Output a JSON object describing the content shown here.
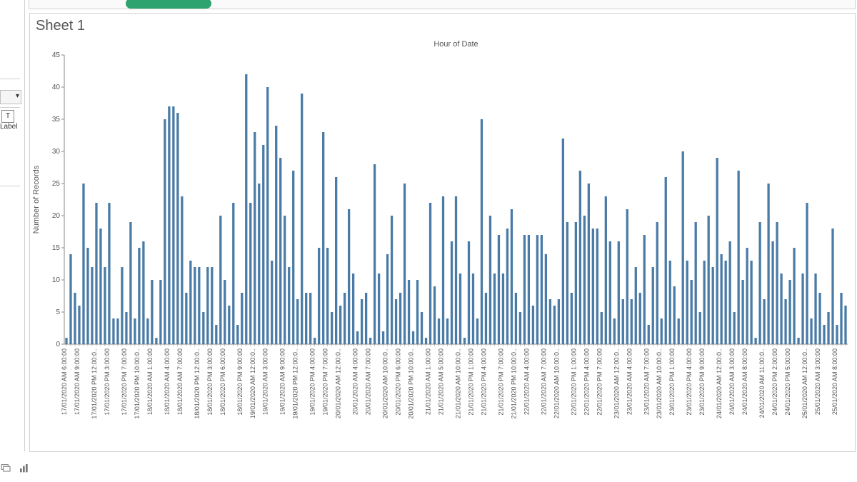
{
  "sheet_title": "Sheet 1",
  "left_panel": {
    "label_text": "Label",
    "t_box": "T",
    "dropdown_caret": "▾"
  },
  "bottom_icons": {
    "icon1": "data-source-icon",
    "icon2": "sheet-icon"
  },
  "chart_data": {
    "type": "bar",
    "title": "Hour of Date",
    "xlabel": "",
    "ylabel": "Number of Records",
    "ylim": [
      0,
      45
    ],
    "yticks": [
      0,
      5,
      10,
      15,
      20,
      25,
      30,
      35,
      40,
      45
    ],
    "categories": [
      "17/01/2020 AM 6:00:00",
      "17/01/2020 AM 9:00:00",
      "17/01/2020 PM 12:00:0..",
      "17/01/2020 PM 3:00:00",
      "17/01/2020 PM 7:00:00",
      "17/01/2020 PM 10:00:0..",
      "18/01/2020 AM 1:00:00",
      "18/01/2020 AM 4:00:00",
      "18/01/2020 AM 7:00:00",
      "18/01/2020 PM 12:00:0..",
      "18/01/2020 PM 3:00:00",
      "18/01/2020 PM 6:00:00",
      "18/01/2020 PM 9:00:00",
      "19/01/2020 AM 12:00:0..",
      "19/01/2020 AM 3:00:00",
      "19/01/2020 AM 9:00:00",
      "19/01/2020 PM 12:00:0..",
      "19/01/2020 PM 4:00:00",
      "19/01/2020 PM 7:00:00",
      "20/01/2020 AM 12:00:0..",
      "20/01/2020 AM 4:00:00",
      "20/01/2020 AM 7:00:00",
      "20/01/2020 AM 10:00:0..",
      "20/01/2020 PM 6:00:00",
      "20/01/2020 PM 10:00:0..",
      "21/01/2020 AM 1:00:00",
      "21/01/2020 AM 5:00:00",
      "21/01/2020 AM 10:00:0..",
      "21/01/2020 PM 1:00:00",
      "21/01/2020 PM 4:00:00",
      "21/01/2020 PM 7:00:00",
      "21/01/2020 PM 10:00:0..",
      "22/01/2020 AM 4:00:00",
      "22/01/2020 AM 7:00:00",
      "22/01/2020 AM 10:00:0..",
      "22/01/2020 PM 1:00:00",
      "22/01/2020 PM 4:00:00",
      "22/01/2020 PM 7:00:00",
      "23/01/2020 AM 12:00:0..",
      "23/01/2020 AM 4:00:00",
      "23/01/2020 AM 7:00:00",
      "23/01/2020 AM 10:00:0..",
      "23/01/2020 PM 1:00:00",
      "23/01/2020 PM 4:00:00",
      "23/01/2020 PM 9:00:00",
      "24/01/2020 AM 12:00:0..",
      "24/01/2020 AM 3:00:00",
      "24/01/2020 AM 8:00:00",
      "24/01/2020 AM 11:00:0..",
      "24/01/2020 PM 2:00:00",
      "24/01/2020 PM 5:00:00",
      "25/01/2020 AM 12:00:0..",
      "25/01/2020 AM 3:00:00",
      "25/01/2020 AM 8:00:00"
    ],
    "values": [
      1,
      14,
      8,
      6,
      25,
      15,
      12,
      22,
      18,
      12,
      22,
      4,
      4,
      12,
      5,
      19,
      4,
      15,
      16,
      4,
      10,
      1,
      10,
      35,
      37,
      37,
      36,
      23,
      8,
      13,
      12,
      12,
      5,
      12,
      12,
      3,
      20,
      10,
      6,
      22,
      3,
      8,
      42,
      22,
      33,
      25,
      31,
      40,
      13,
      34,
      29,
      20,
      12,
      27,
      7,
      39,
      8,
      8,
      1,
      15,
      33,
      15,
      5,
      26,
      6,
      8,
      21,
      11,
      2,
      7,
      8,
      1,
      28,
      11,
      2,
      14,
      20,
      7,
      8,
      25,
      10,
      2,
      10,
      5,
      1,
      22,
      9,
      4,
      23,
      4,
      16,
      23,
      11,
      1,
      16,
      11,
      4,
      35,
      8,
      20,
      11,
      17,
      11,
      18,
      21,
      8,
      5,
      17,
      17,
      6,
      17,
      17,
      14,
      7,
      6,
      7,
      32,
      19,
      8,
      19,
      27,
      20,
      25,
      18,
      18,
      5,
      23,
      16,
      4,
      16,
      7,
      21,
      7,
      12,
      8,
      17,
      3,
      12,
      19,
      4,
      26,
      13,
      9,
      4,
      30,
      13,
      10,
      19,
      5,
      13,
      20,
      12,
      29,
      14,
      13,
      16,
      5,
      27,
      10,
      15,
      13,
      1,
      19,
      7,
      25,
      16,
      19,
      11,
      7,
      10,
      15,
      1,
      11,
      22,
      4,
      11,
      8,
      3,
      5,
      18,
      3,
      8,
      6
    ],
    "bar_color": "#4a7ba6"
  }
}
